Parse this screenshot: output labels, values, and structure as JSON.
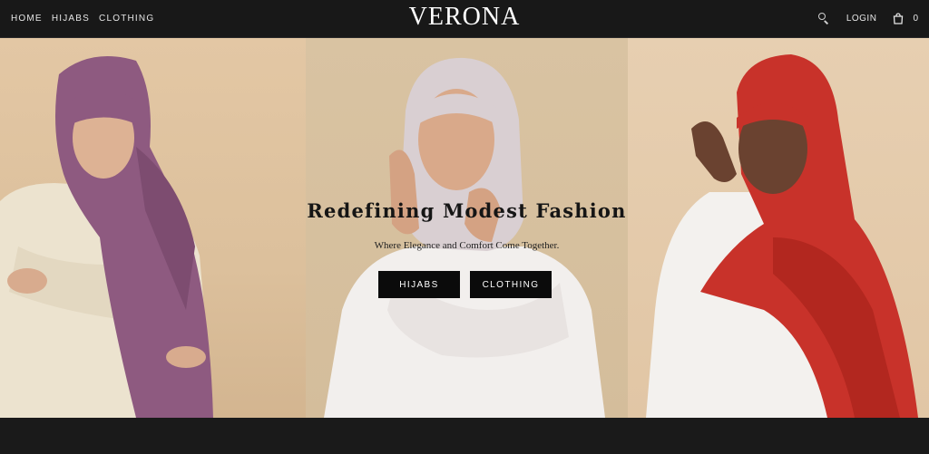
{
  "header": {
    "nav": [
      {
        "label": "HOME"
      },
      {
        "label": "HIJABS"
      },
      {
        "label": "CLOTHING"
      }
    ],
    "logo": "VERONA",
    "login_label": "LOGIN",
    "cart_count": "0",
    "icons": {
      "search": "search-icon",
      "cart": "shopping-bag-icon"
    }
  },
  "hero": {
    "title": "Redefining Modest Fashion",
    "subtitle": "Where Elegance and Comfort Come Together.",
    "buttons": [
      {
        "label": "HIJABS"
      },
      {
        "label": "CLOTHING"
      }
    ],
    "colors": {
      "left_hijab": "#8e5a80",
      "center_hijab": "#d9cfd2",
      "right_hijab": "#c8322a",
      "button_bg": "#0b0b0b"
    }
  }
}
